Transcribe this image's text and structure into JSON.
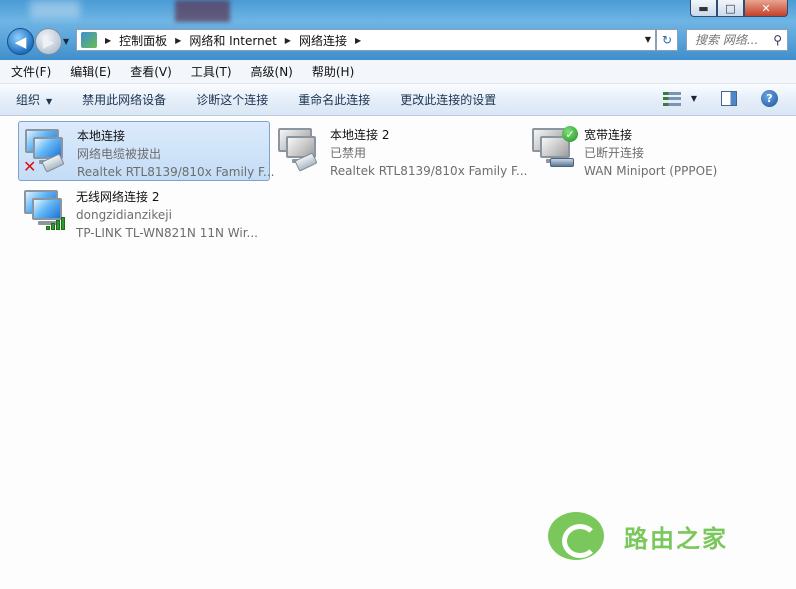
{
  "window": {
    "buttons": {
      "minimize": "▬",
      "maximize": "□",
      "close": "✕"
    }
  },
  "address_bar": {
    "breadcrumbs": [
      "控制面板",
      "网络和 Internet",
      "网络连接"
    ]
  },
  "search": {
    "placeholder": "搜索 网络..."
  },
  "menu": [
    "文件(F)",
    "编辑(E)",
    "查看(V)",
    "工具(T)",
    "高级(N)",
    "帮助(H)"
  ],
  "toolbar": {
    "organize": "组织",
    "disable": "禁用此网络设备",
    "diagnose": "诊断这个连接",
    "rename": "重命名此连接",
    "change_settings": "更改此连接的设置",
    "help": "?"
  },
  "connections": [
    {
      "name": "本地连接",
      "status": "网络电缆被拔出",
      "device": "Realtek RTL8139/810x Family F...",
      "icon": "ethernet-unplugged-icon",
      "selected": true
    },
    {
      "name": "本地连接 2",
      "status": "已禁用",
      "device": "Realtek RTL8139/810x Family F...",
      "icon": "ethernet-disabled-icon",
      "selected": false
    },
    {
      "name": "宽带连接",
      "status": "已断开连接",
      "device": "WAN Miniport (PPPOE)",
      "icon": "broadband-icon",
      "selected": false
    },
    {
      "name": "无线网络连接 2",
      "status": "dongzidianzikeji",
      "device": "TP-LINK TL-WN821N 11N Wir...",
      "icon": "wireless-icon",
      "selected": false
    }
  ],
  "watermark": {
    "text": "路由之家",
    "color": "#6cc24a"
  },
  "colors": {
    "selection": "#c4dcf6",
    "chrome": "#5fa8dc"
  }
}
